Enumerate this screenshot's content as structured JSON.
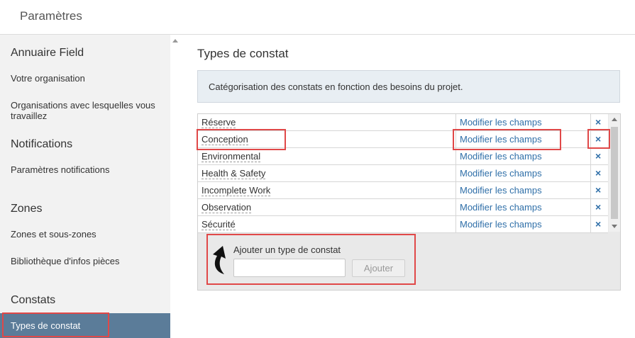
{
  "header": {
    "title": "Paramètres"
  },
  "sidebar": {
    "sections": [
      {
        "label": "Annuaire Field"
      },
      {
        "label": "Notifications"
      },
      {
        "label": "Zones"
      },
      {
        "label": "Constats"
      }
    ],
    "items": [
      {
        "label": "Votre organisation"
      },
      {
        "label": "Organisations avec lesquelles vous travaillez"
      },
      {
        "label": "Paramètres notifications"
      },
      {
        "label": "Zones et sous-zones"
      },
      {
        "label": "Bibliothèque d'infos pièces"
      },
      {
        "label": "Types de constat"
      }
    ]
  },
  "main": {
    "title": "Types de constat",
    "description": "Catégorisation des constats en fonction des besoins du projet.",
    "rows": [
      {
        "name": "Réserve",
        "edit": "Modifier les champs",
        "delete": "×"
      },
      {
        "name": "Conception",
        "edit": "Modifier les champs",
        "delete": "×"
      },
      {
        "name": "Environmental",
        "edit": "Modifier les champs",
        "delete": "×"
      },
      {
        "name": "Health & Safety",
        "edit": "Modifier les champs",
        "delete": "×"
      },
      {
        "name": "Incomplete Work",
        "edit": "Modifier les champs",
        "delete": "×"
      },
      {
        "name": "Observation",
        "edit": "Modifier les champs",
        "delete": "×"
      },
      {
        "name": "Sécurité",
        "edit": "Modifier les champs",
        "delete": "×"
      }
    ],
    "add": {
      "label": "Ajouter un type de constat",
      "input_value": "",
      "button_label": "Ajouter"
    }
  },
  "colors": {
    "accent_sidebar": "#5b7c99",
    "link": "#2f6fa8",
    "highlight": "#e04848"
  }
}
